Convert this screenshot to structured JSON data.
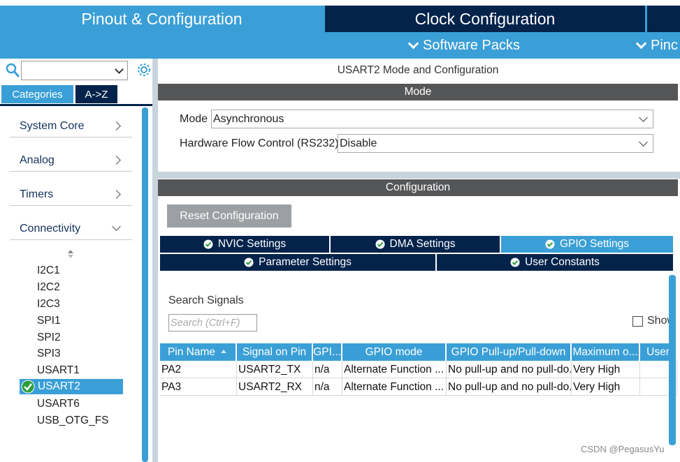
{
  "header": {
    "tabs": [
      {
        "label": "Pinout & Configuration",
        "active": true
      },
      {
        "label": "Clock Configuration",
        "active": false
      }
    ],
    "subtabs": [
      {
        "label": "Software Packs"
      },
      {
        "label": "Pinc"
      }
    ]
  },
  "sidebar": {
    "search": {
      "value": ""
    },
    "tabs": [
      {
        "label": "Categories",
        "active": true
      },
      {
        "label": "A->Z",
        "active": false
      }
    ],
    "categories": [
      {
        "label": "System Core",
        "expanded": false
      },
      {
        "label": "Analog",
        "expanded": false
      },
      {
        "label": "Timers",
        "expanded": false
      },
      {
        "label": "Connectivity",
        "expanded": true
      }
    ],
    "connectivity_items": [
      {
        "label": "I2C1",
        "selected": false
      },
      {
        "label": "I2C2",
        "selected": false
      },
      {
        "label": "I2C3",
        "selected": false
      },
      {
        "label": "SPI1",
        "selected": false
      },
      {
        "label": "SPI2",
        "selected": false
      },
      {
        "label": "SPI3",
        "selected": false
      },
      {
        "label": "USART1",
        "selected": false
      },
      {
        "label": "USART2",
        "selected": true
      },
      {
        "label": "USART6",
        "selected": false
      },
      {
        "label": "USB_OTG_FS",
        "selected": false
      }
    ]
  },
  "main": {
    "title": "USART2 Mode and Configuration",
    "mode_header": "Mode",
    "mode": {
      "label": "Mode",
      "value": "Asynchronous"
    },
    "flow_control": {
      "label": "Hardware Flow Control (RS232)",
      "value": "Disable"
    },
    "config_header": "Configuration",
    "reset_button": "Reset Configuration",
    "config_tabs": [
      {
        "label": "NVIC Settings",
        "active": false
      },
      {
        "label": "DMA Settings",
        "active": false
      },
      {
        "label": "GPIO Settings",
        "active": true
      },
      {
        "label": "Parameter Settings",
        "active": false
      },
      {
        "label": "User Constants",
        "active": false
      }
    ],
    "search_signals_label": "Search Signals",
    "search_signals_placeholder": "Search (Ctrl+F)",
    "show_label": "Show",
    "table": {
      "columns": [
        "Pin Name",
        "Signal on Pin",
        "GPI...",
        "GPIO mode",
        "GPIO Pull-up/Pull-down",
        "Maximum o...",
        "User"
      ],
      "rows": [
        [
          "PA2",
          "USART2_TX",
          "n/a",
          "Alternate Function ...",
          "No pull-up and no pull-do...",
          "Very High",
          ""
        ],
        [
          "PA3",
          "USART2_RX",
          "n/a",
          "Alternate Function ...",
          "No pull-up and no pull-do...",
          "Very High",
          ""
        ]
      ]
    }
  },
  "watermark": "CSDN @PegasusYu",
  "colors": {
    "accent": "#3a9fd6",
    "navy": "#03234b",
    "section": "#555658",
    "button": "#9ca0a4"
  }
}
